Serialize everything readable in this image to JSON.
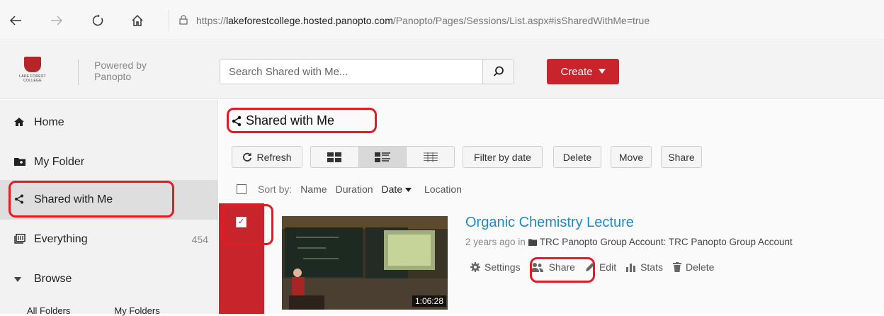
{
  "browser": {
    "url_prefix": "https://",
    "url_domain": "lakeforestcollege.hosted.panopto.com",
    "url_path": "/Panopto/Pages/Sessions/List.aspx#isSharedWithMe=true"
  },
  "header": {
    "logo_text": "LAKE FOREST COLLEGE",
    "powered_line1": "Powered by",
    "powered_line2": "Panopto",
    "search_placeholder": "Search Shared with Me...",
    "create_label": "Create"
  },
  "sidebar": {
    "items": [
      {
        "label": "Home",
        "icon": "home-icon"
      },
      {
        "label": "My Folder",
        "icon": "folder-icon"
      },
      {
        "label": "Shared with Me",
        "icon": "share-icon"
      },
      {
        "label": "Everything",
        "icon": "everything-icon",
        "count": "454"
      },
      {
        "label": "Browse",
        "icon": "triangle-down-icon"
      }
    ],
    "sub_links": [
      "All Folders",
      "My Folders"
    ]
  },
  "main": {
    "title": "Shared with Me",
    "toolbar": {
      "refresh": "Refresh",
      "filter": "Filter by date",
      "delete": "Delete",
      "move": "Move",
      "share": "Share"
    },
    "sort": {
      "label": "Sort by:",
      "name": "Name",
      "duration": "Duration",
      "date": "Date",
      "location": "Location"
    },
    "recording": {
      "title": "Organic Chemistry Lecture",
      "age": "2 years ago in",
      "folder": "TRC Panopto Group Account: TRC Panopto Group Account",
      "duration": "1:06:28",
      "actions": {
        "settings": "Settings",
        "share": "Share",
        "edit": "Edit",
        "stats": "Stats",
        "delete": "Delete"
      }
    }
  },
  "colors": {
    "accent_red": "#c9242b",
    "link_blue": "#1e8bc3",
    "highlight_red": "#e51b24"
  }
}
